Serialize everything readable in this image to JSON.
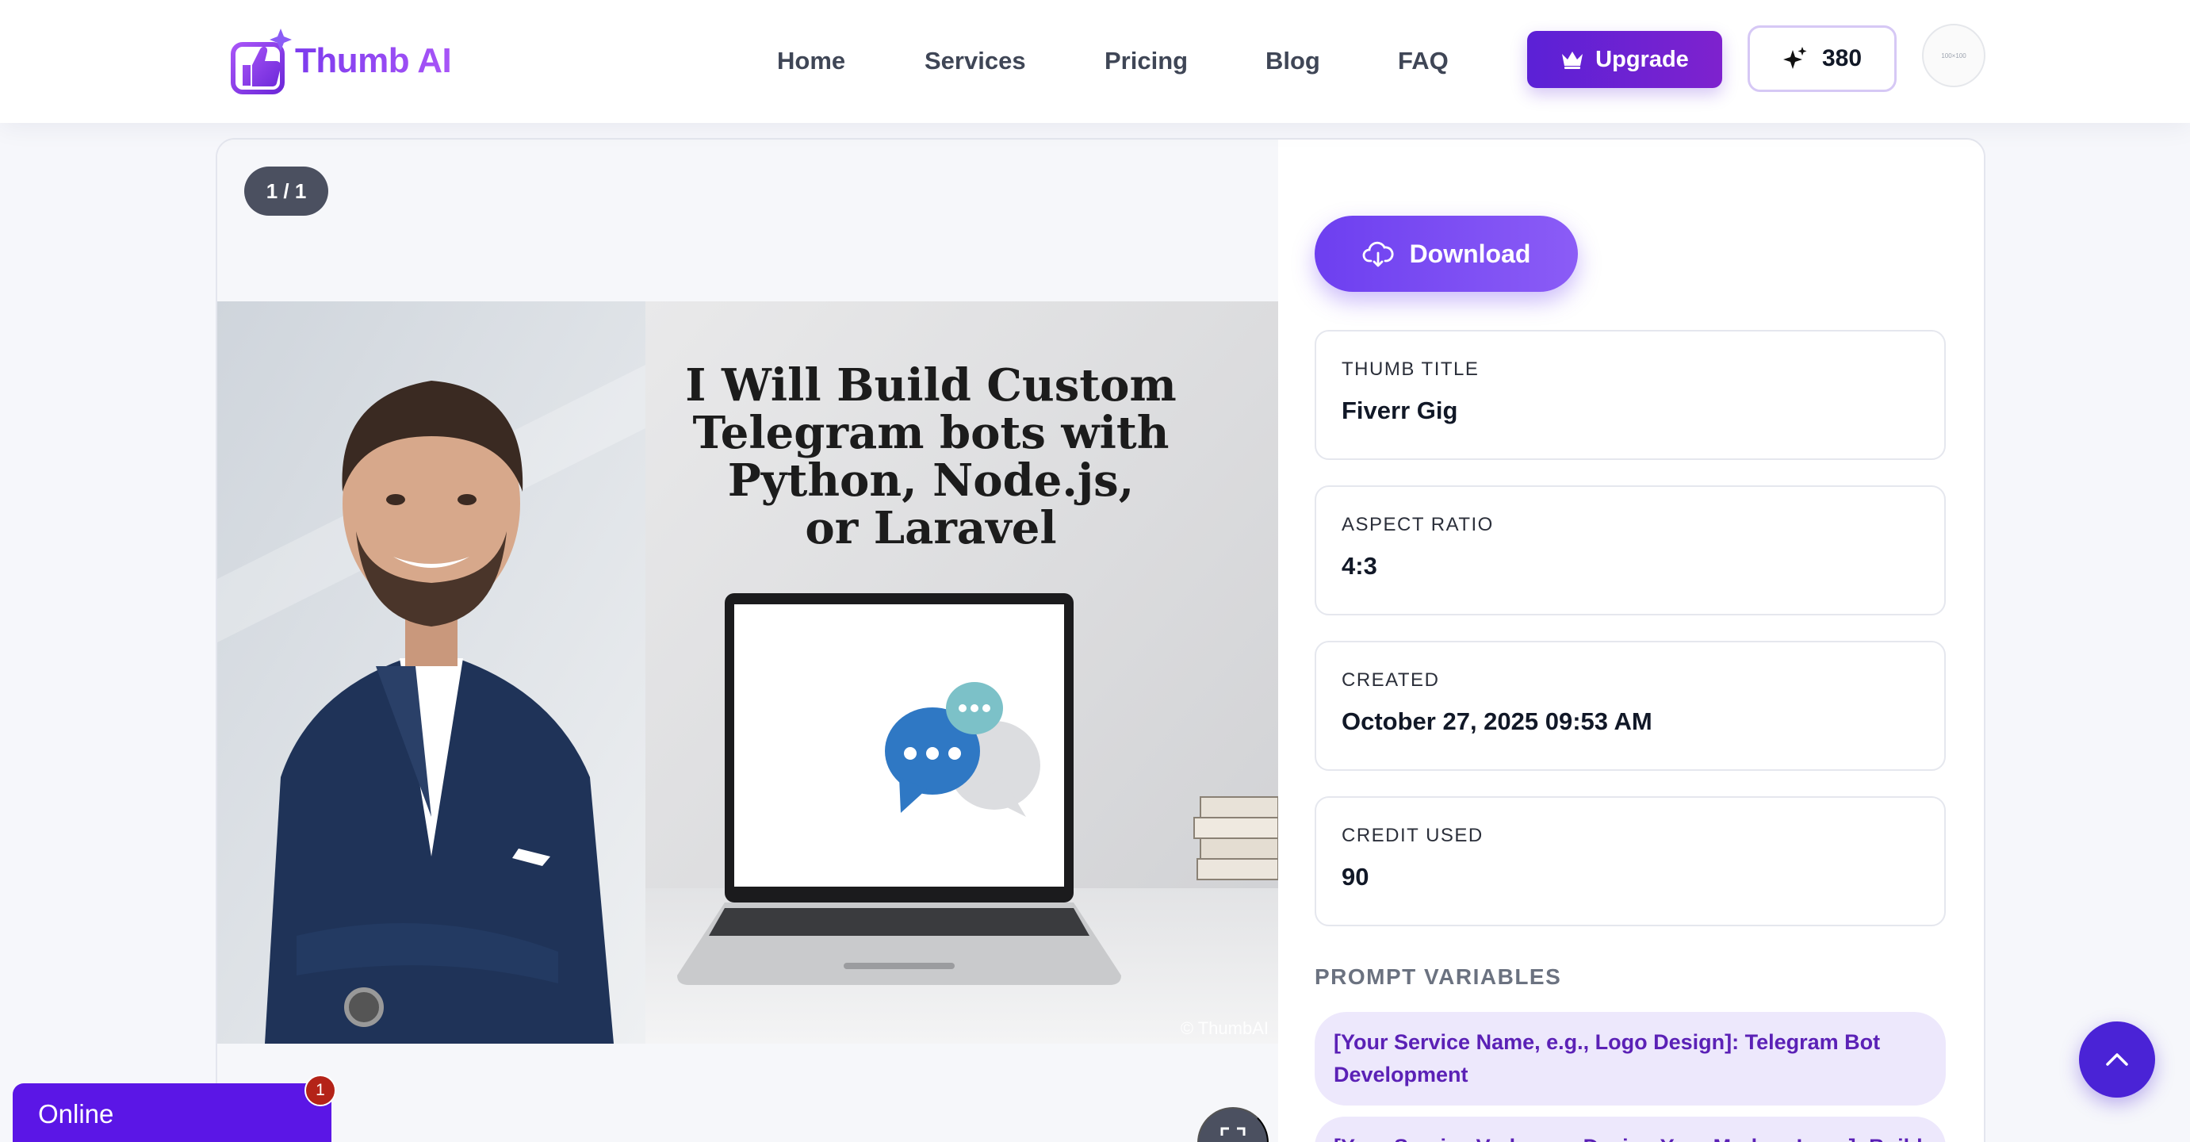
{
  "brand": {
    "name": "Thumb AI"
  },
  "nav": {
    "links": [
      {
        "label": "Home"
      },
      {
        "label": "Services"
      },
      {
        "label": "Pricing"
      },
      {
        "label": "Blog"
      },
      {
        "label": "FAQ"
      }
    ],
    "upgrade_label": "Upgrade",
    "credits": "380",
    "avatar_placeholder": "100×100"
  },
  "viewer": {
    "counter": "1 / 1",
    "thumbnail": {
      "headline_lines": [
        "I Will Build Custom",
        "Telegram bots with",
        "Python, Node.js,",
        "or Laravel"
      ],
      "watermark": "© ThumbAI"
    }
  },
  "details": {
    "download_label": "Download",
    "fields": [
      {
        "label": "THUMB TITLE",
        "value": "Fiverr Gig"
      },
      {
        "label": "ASPECT RATIO",
        "value": "4:3"
      },
      {
        "label": "CREATED",
        "value": "October 27, 2025 09:53 AM"
      },
      {
        "label": "CREDIT USED",
        "value": "90"
      }
    ],
    "prompt_heading": "PROMPT VARIABLES",
    "prompt_variables": [
      "[Your Service Name, e.g., Logo Design]: Telegram Bot Development",
      "[Your Service Verb, e.g., Design Your Modern Logo]: Build"
    ]
  },
  "chat": {
    "status": "Online",
    "badge": "1"
  },
  "colors": {
    "brand_purple": "#7c3aed",
    "upgrade": "#5b21d6",
    "download": "#6d3ff0",
    "chat": "#5b16e6",
    "badge": "#b42318"
  }
}
